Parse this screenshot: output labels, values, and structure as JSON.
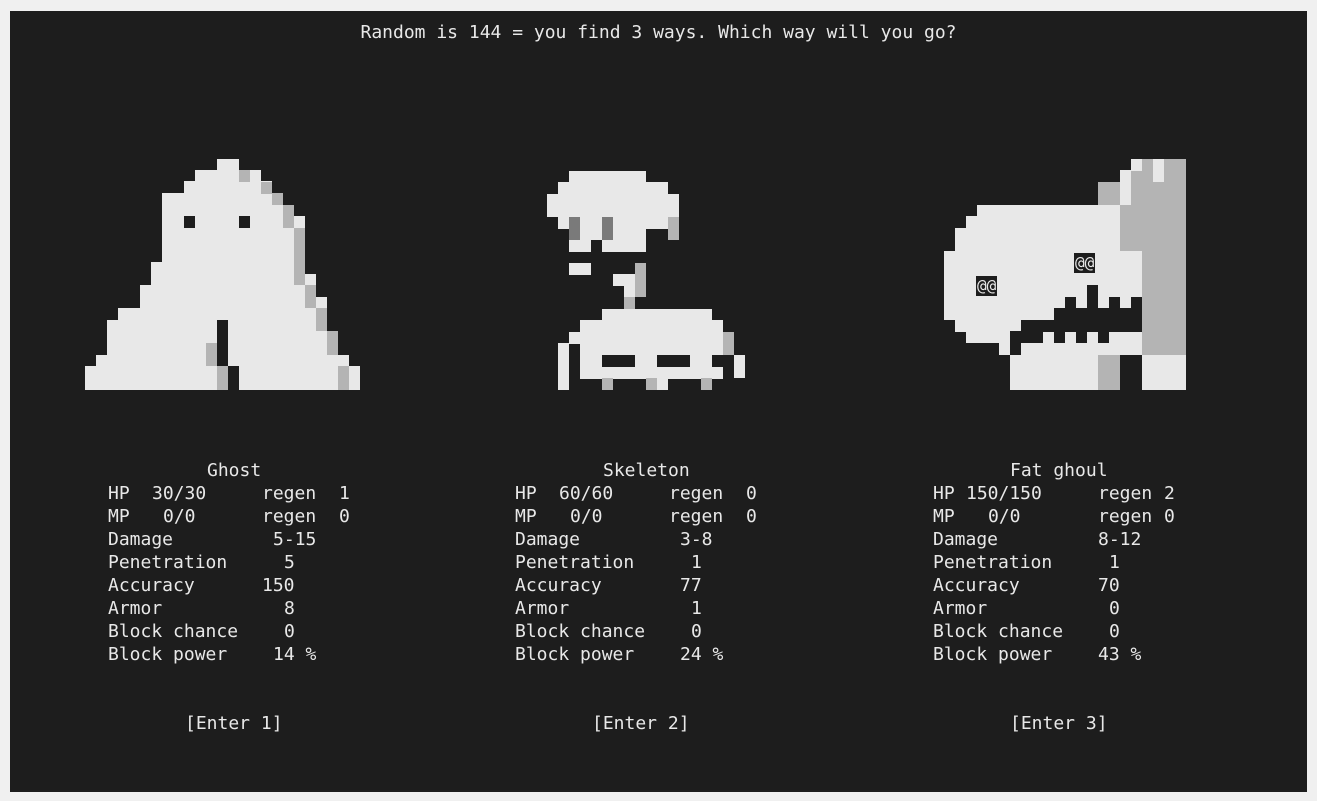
{
  "prompt": "Random is 144 = you find 3 ways. Which way will you go?",
  "palette": {
    "background": "#1d1d1d",
    "text": "#e8e8e8",
    "sprite_light": "#e8e8e8",
    "sprite_gray": "#b4b4b4",
    "sprite_dark": "#7a7a7a"
  },
  "labels": {
    "hp": "HP",
    "mp": "MP",
    "regen": "regen",
    "damage": "Damage",
    "penetration": "Penetration",
    "accuracy": "Accuracy",
    "armor": "Armor",
    "block_chance": "Block chance",
    "block_power": "Block power"
  },
  "monsters": [
    {
      "name": "Ghost",
      "hp": "30/30",
      "hp_regen": "1",
      "mp": "0/0",
      "mp_regen": "0",
      "damage": "5-15",
      "penetration": "5",
      "accuracy": "150",
      "armor": "8",
      "block_chance": "0",
      "block_power": "14 %",
      "enter": "[Enter 1]",
      "icon": "ghost-sprite"
    },
    {
      "name": "Skeleton",
      "hp": "60/60",
      "hp_regen": "0",
      "mp": "0/0",
      "mp_regen": "0",
      "damage": "3-8",
      "penetration": "1",
      "accuracy": "77",
      "armor": "1",
      "block_chance": "0",
      "block_power": "24 %",
      "enter": "[Enter 2]",
      "icon": "skeleton-sprite"
    },
    {
      "name": "Fat ghoul",
      "hp": "150/150",
      "hp_regen": "2",
      "mp": "0/0",
      "mp_regen": "0",
      "damage": "8-12",
      "penetration": "1",
      "accuracy": "70",
      "armor": "0",
      "block_chance": "0",
      "block_power": "43 %",
      "enter": "[Enter 3]",
      "icon": "ghoul-sprite",
      "eye_glyphs": "@@"
    }
  ]
}
